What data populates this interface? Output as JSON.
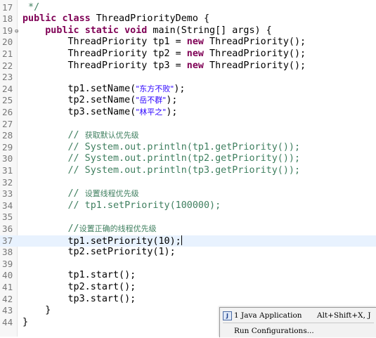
{
  "editor": {
    "lines": [
      {
        "num": "17",
        "segments": [
          {
            "t": " */",
            "c": "cm"
          }
        ]
      },
      {
        "num": "18",
        "segments": [
          {
            "t": "public",
            "c": "kw"
          },
          {
            "t": " "
          },
          {
            "t": "class",
            "c": "kw"
          },
          {
            "t": " ThreadPriorityDemo {"
          }
        ]
      },
      {
        "num": "19",
        "fold": "⊖",
        "segments": [
          {
            "t": "    "
          },
          {
            "t": "public",
            "c": "kw"
          },
          {
            "t": " "
          },
          {
            "t": "static",
            "c": "kw"
          },
          {
            "t": " "
          },
          {
            "t": "void",
            "c": "kw"
          },
          {
            "t": " main(String[] args) {"
          }
        ]
      },
      {
        "num": "20",
        "segments": [
          {
            "t": "        ThreadPriority tp1 = "
          },
          {
            "t": "new",
            "c": "kw"
          },
          {
            "t": " ThreadPriority();"
          }
        ]
      },
      {
        "num": "21",
        "segments": [
          {
            "t": "        ThreadPriority tp2 = "
          },
          {
            "t": "new",
            "c": "kw"
          },
          {
            "t": " ThreadPriority();"
          }
        ]
      },
      {
        "num": "22",
        "segments": [
          {
            "t": "        ThreadPriority tp3 = "
          },
          {
            "t": "new",
            "c": "kw"
          },
          {
            "t": " ThreadPriority();"
          }
        ]
      },
      {
        "num": "23",
        "segments": []
      },
      {
        "num": "24",
        "segments": [
          {
            "t": "        tp1.setName("
          },
          {
            "t": "\"东方不败\"",
            "c": "str cjk"
          },
          {
            "t": ");"
          }
        ]
      },
      {
        "num": "25",
        "segments": [
          {
            "t": "        tp2.setName("
          },
          {
            "t": "\"岳不群\"",
            "c": "str cjk"
          },
          {
            "t": ");"
          }
        ]
      },
      {
        "num": "26",
        "segments": [
          {
            "t": "        tp3.setName("
          },
          {
            "t": "\"林平之\"",
            "c": "str cjk"
          },
          {
            "t": ");"
          }
        ]
      },
      {
        "num": "27",
        "segments": []
      },
      {
        "num": "28",
        "segments": [
          {
            "t": "        // ",
            "c": "cm"
          },
          {
            "t": "获取默认优先级",
            "c": "cm cjk"
          }
        ]
      },
      {
        "num": "29",
        "segments": [
          {
            "t": "        // System.out.println(tp1.getPriority());",
            "c": "cm"
          }
        ]
      },
      {
        "num": "30",
        "segments": [
          {
            "t": "        // System.out.println(tp2.getPriority());",
            "c": "cm"
          }
        ]
      },
      {
        "num": "31",
        "segments": [
          {
            "t": "        // System.out.println(tp3.getPriority());",
            "c": "cm"
          }
        ]
      },
      {
        "num": "32",
        "segments": []
      },
      {
        "num": "33",
        "segments": [
          {
            "t": "        // ",
            "c": "cm"
          },
          {
            "t": "设置线程优先级",
            "c": "cm cjk"
          }
        ]
      },
      {
        "num": "34",
        "segments": [
          {
            "t": "        // tp1.setPriority(100000);",
            "c": "cm"
          }
        ]
      },
      {
        "num": "35",
        "segments": []
      },
      {
        "num": "36",
        "segments": [
          {
            "t": "        //",
            "c": "cm"
          },
          {
            "t": "设置正确的线程优先级",
            "c": "cm cjk"
          }
        ]
      },
      {
        "num": "37",
        "current": true,
        "caret": true,
        "segments": [
          {
            "t": "        tp1.setPriority(10);"
          }
        ]
      },
      {
        "num": "38",
        "segments": [
          {
            "t": "        tp2.setPriority(1);"
          }
        ]
      },
      {
        "num": "39",
        "segments": []
      },
      {
        "num": "40",
        "segments": [
          {
            "t": "        tp1.start();"
          }
        ]
      },
      {
        "num": "41",
        "segments": [
          {
            "t": "        tp2.start();"
          }
        ]
      },
      {
        "num": "42",
        "segments": [
          {
            "t": "        tp3.start();"
          }
        ]
      },
      {
        "num": "43",
        "segments": [
          {
            "t": "    }"
          }
        ]
      },
      {
        "num": "44",
        "segments": [
          {
            "t": "}"
          }
        ]
      }
    ],
    "colors": {
      "keyword": "#7f0055",
      "comment": "#3f7f5f",
      "string": "#2a00ff",
      "current_line": "#e8f2fe"
    }
  },
  "run_menu": {
    "items": [
      {
        "icon": "java-application-icon",
        "icon_glyph": "J",
        "label": "1 Java Application",
        "shortcut": "Alt+Shift+X, J"
      },
      {
        "label": "Run Configurations..."
      }
    ]
  }
}
